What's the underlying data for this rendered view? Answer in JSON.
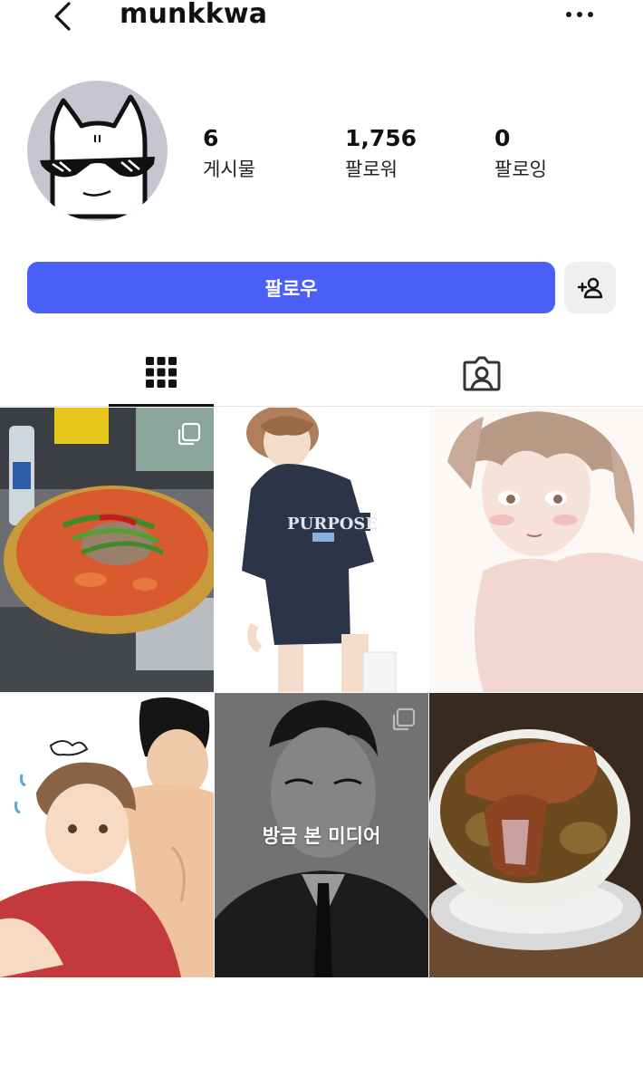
{
  "header": {
    "username": "munkkwa",
    "back_icon": "chevron-left-icon",
    "more_icon": "ellipsis-icon"
  },
  "profile": {
    "stats": [
      {
        "value": "6",
        "label": "게시물"
      },
      {
        "value": "1,756",
        "label": "팔로워"
      },
      {
        "value": "0",
        "label": "팔로잉"
      }
    ]
  },
  "actions": {
    "follow_label": "팔로우",
    "follow_color": "#4a5ff7",
    "add_user_icon": "add-user-icon"
  },
  "tabs": [
    {
      "icon": "grid-icon",
      "active": true
    },
    {
      "icon": "tagged-person-icon",
      "active": false
    }
  ],
  "grid": {
    "recently_viewed_label": "방금 본 미디어"
  }
}
